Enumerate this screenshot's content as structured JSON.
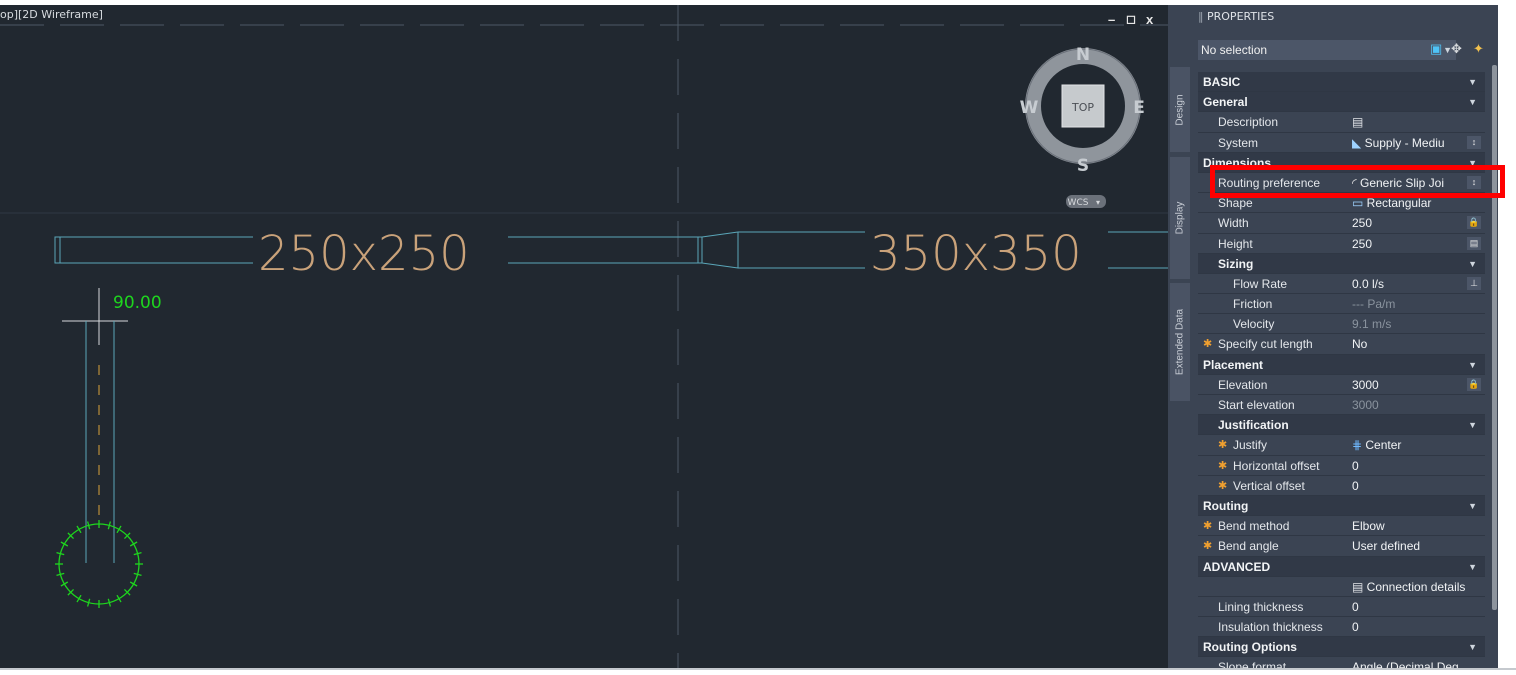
{
  "viewport": {
    "label": "op][2D Wireframe]",
    "controls": {
      "minimize": "–",
      "restore": "◻",
      "close": "x"
    },
    "viewcube": {
      "north": "N",
      "south": "S",
      "east": "E",
      "west": "W",
      "top_face": "TOP",
      "wcs": "WCS"
    },
    "duct_label_left": "250x250",
    "duct_label_right": "350x350",
    "angle_readout": "90.00"
  },
  "properties": {
    "title": "PROPERTIES",
    "selection": "No selection",
    "tabs": [
      "Design",
      "Display",
      "Extended Data"
    ],
    "rows": [
      {
        "type": "section",
        "indent": 0,
        "label": "BASIC"
      },
      {
        "type": "section",
        "indent": 0,
        "label": "General"
      },
      {
        "type": "prop",
        "indent": 1,
        "label": "Description",
        "value": "",
        "icon": "description-icon"
      },
      {
        "type": "prop",
        "indent": 1,
        "label": "System",
        "value": "Supply - Mediu",
        "icon": "system-icon",
        "btn": "↕"
      },
      {
        "type": "section",
        "indent": 0,
        "label": "Dimensions"
      },
      {
        "type": "prop",
        "indent": 1,
        "label": "Routing preference",
        "value": "Generic Slip Joi",
        "icon": "elbow-icon",
        "btn": "↕"
      },
      {
        "type": "prop",
        "indent": 1,
        "label": "Shape",
        "value": "Rectangular",
        "icon": "shape-icon"
      },
      {
        "type": "prop",
        "indent": 1,
        "label": "Width",
        "value": "250",
        "btn": "🔒"
      },
      {
        "type": "prop",
        "indent": 1,
        "label": "Height",
        "value": "250",
        "btn": "▤"
      },
      {
        "type": "section",
        "indent": 1,
        "label": "Sizing"
      },
      {
        "type": "prop",
        "indent": 2,
        "label": "Flow Rate",
        "value": "0.0 l/s",
        "btn": "⊥"
      },
      {
        "type": "prop",
        "indent": 2,
        "label": "Friction",
        "value": "--- Pa/m",
        "dim": true
      },
      {
        "type": "prop",
        "indent": 2,
        "label": "Velocity",
        "value": "9.1 m/s",
        "dim": true
      },
      {
        "type": "prop",
        "indent": 1,
        "label": "Specify cut length",
        "value": "No",
        "star": true
      },
      {
        "type": "section",
        "indent": 0,
        "label": "Placement"
      },
      {
        "type": "prop",
        "indent": 1,
        "label": "Elevation",
        "value": "3000",
        "btn": "🔒"
      },
      {
        "type": "prop",
        "indent": 1,
        "label": "Start elevation",
        "value": "3000",
        "dim": true
      },
      {
        "type": "section",
        "indent": 1,
        "label": "Justification"
      },
      {
        "type": "prop",
        "indent": 2,
        "label": "Justify",
        "value": "Center",
        "icon": "justify-icon",
        "star": true
      },
      {
        "type": "prop",
        "indent": 2,
        "label": "Horizontal offset",
        "value": "0",
        "star": true
      },
      {
        "type": "prop",
        "indent": 2,
        "label": "Vertical offset",
        "value": "0",
        "star": true
      },
      {
        "type": "section",
        "indent": 0,
        "label": "Routing"
      },
      {
        "type": "prop",
        "indent": 1,
        "label": "Bend method",
        "value": "Elbow",
        "star": true
      },
      {
        "type": "prop",
        "indent": 1,
        "label": "Bend angle",
        "value": "User defined",
        "star": true
      },
      {
        "type": "section",
        "indent": 0,
        "label": "ADVANCED"
      },
      {
        "type": "prop",
        "indent": 1,
        "label": "",
        "value": "Connection details",
        "icon": "details-icon"
      },
      {
        "type": "prop",
        "indent": 1,
        "label": "Lining thickness",
        "value": "0"
      },
      {
        "type": "prop",
        "indent": 1,
        "label": "Insulation thickness",
        "value": "0"
      },
      {
        "type": "section",
        "indent": 0,
        "label": "Routing Options"
      },
      {
        "type": "prop",
        "indent": 1,
        "label": "Slope format",
        "value": "Angle (Decimal Deg"
      }
    ]
  },
  "colors": {
    "viewport_bg": "#212830",
    "panel_bg": "#3b4453",
    "duct_line": "#5aa6b8",
    "duct_text": "#c9a27a",
    "green": "#1ed51e",
    "highlight": "#ff0000"
  }
}
